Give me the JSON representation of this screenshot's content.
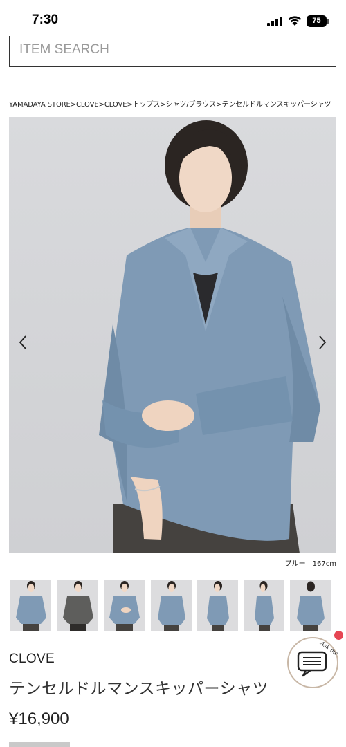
{
  "status_bar": {
    "time": "7:30",
    "battery": "75"
  },
  "search": {
    "placeholder": "ITEM SEARCH",
    "value": ""
  },
  "breadcrumb": "YAMADAYA STORE>CLOVE>CLOVE>トップス>シャツ/ブラウス>テンセルドルマンスキッパーシャツ",
  "gallery": {
    "prev_icon": "chevron-left-icon",
    "next_icon": "chevron-right-icon",
    "caption": "ブルー　167cm",
    "thumbnail_count": 7,
    "colors": {
      "shirt_blue": "#7f9ab5",
      "shirt_gray": "#5e5e5c",
      "skirt": "#45423f"
    }
  },
  "product": {
    "brand": "CLOVE",
    "name": "テンセルドルマンスキッパーシャツ",
    "price": "¥16,900"
  },
  "chat": {
    "label": "Ask me",
    "icon": "chat-bubble-icon",
    "badge_color": "#e64553"
  }
}
